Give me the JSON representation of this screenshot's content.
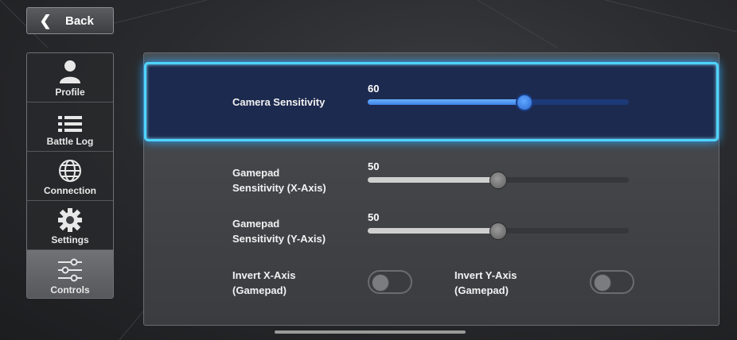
{
  "back": {
    "label": "Back"
  },
  "sidebar": {
    "items": [
      {
        "label": "Profile",
        "icon": "person-icon"
      },
      {
        "label": "Battle Log",
        "icon": "list-icon"
      },
      {
        "label": "Connection",
        "icon": "globe-icon"
      },
      {
        "label": "Settings",
        "icon": "gear-icon"
      },
      {
        "label": "Controls",
        "icon": "sliders-icon",
        "active": true
      }
    ]
  },
  "settings": {
    "camera": {
      "label": "Camera Sensitivity",
      "value": "60",
      "level": 0.6
    },
    "gamepad_x": {
      "label_line1": "Gamepad",
      "label_line2": "Sensitivity (X-Axis)",
      "value": "50",
      "level": 0.5
    },
    "gamepad_y": {
      "label_line1": "Gamepad",
      "label_line2": "Sensitivity (Y-Axis)",
      "value": "50",
      "level": 0.5
    },
    "invert_x": {
      "label_line1": "Invert X-Axis",
      "label_line2": "(Gamepad)",
      "on": false
    },
    "invert_y": {
      "label_line1": "Invert Y-Axis",
      "label_line2": "(Gamepad)",
      "on": false
    }
  },
  "colors": {
    "highlight_border": "#4fd4ff",
    "slider_active": "#3d82e8"
  }
}
